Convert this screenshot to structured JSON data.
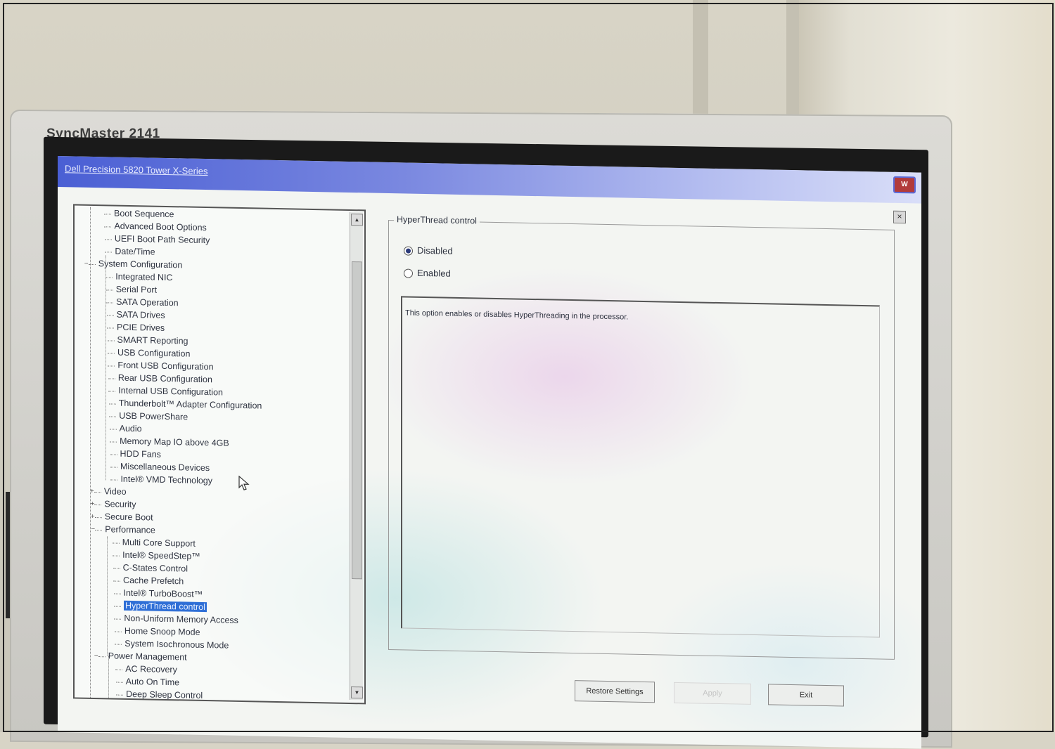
{
  "monitor": {
    "brand": "SyncMaster 2141"
  },
  "window": {
    "title": "Dell Precision 5820 Tower X-Series",
    "logo": "W"
  },
  "tree": {
    "items": [
      {
        "label": "Boot Sequence"
      },
      {
        "label": "Advanced Boot Options"
      },
      {
        "label": "UEFI Boot Path Security"
      },
      {
        "label": "Date/Time"
      },
      {
        "label": "System Configuration"
      },
      {
        "label": "Integrated NIC"
      },
      {
        "label": "Serial Port"
      },
      {
        "label": "SATA Operation"
      },
      {
        "label": "SATA Drives"
      },
      {
        "label": "PCIE Drives"
      },
      {
        "label": "SMART Reporting"
      },
      {
        "label": "USB Configuration"
      },
      {
        "label": "Front USB Configuration"
      },
      {
        "label": "Rear USB Configuration"
      },
      {
        "label": "Internal USB Configuration"
      },
      {
        "label": "Thunderbolt™ Adapter Configuration"
      },
      {
        "label": "USB PowerShare"
      },
      {
        "label": "Audio"
      },
      {
        "label": "Memory Map IO above 4GB"
      },
      {
        "label": "HDD Fans"
      },
      {
        "label": "Miscellaneous Devices"
      },
      {
        "label": "Intel® VMD Technology"
      },
      {
        "label": "Video"
      },
      {
        "label": "Security"
      },
      {
        "label": "Secure Boot"
      },
      {
        "label": "Performance"
      },
      {
        "label": "Multi Core Support"
      },
      {
        "label": "Intel® SpeedStep™"
      },
      {
        "label": "C-States Control"
      },
      {
        "label": "Cache Prefetch"
      },
      {
        "label": "Intel® TurboBoost™"
      },
      {
        "label": "HyperThread control"
      },
      {
        "label": "Non-Uniform Memory Access"
      },
      {
        "label": "Home Snoop Mode"
      },
      {
        "label": "System Isochronous Mode"
      },
      {
        "label": "Power Management"
      },
      {
        "label": "AC Recovery"
      },
      {
        "label": "Auto On Time"
      },
      {
        "label": "Deep Sleep Control"
      }
    ],
    "selected": "HyperThread control"
  },
  "setting": {
    "group_title": "HyperThread control",
    "options": [
      {
        "label": "Disabled",
        "checked": true
      },
      {
        "label": "Enabled",
        "checked": false
      }
    ],
    "description": "This option enables or disables HyperThreading in the processor."
  },
  "buttons": {
    "restore": "Restore Settings",
    "apply": "Apply",
    "exit": "Exit"
  }
}
